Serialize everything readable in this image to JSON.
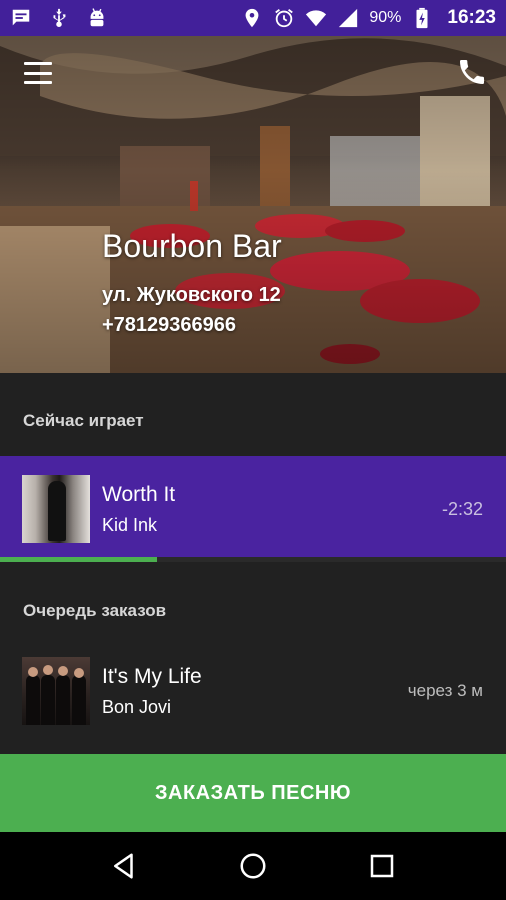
{
  "status_bar": {
    "battery": "90%",
    "time": "16:23",
    "left_icons": [
      "message-icon",
      "usb-icon",
      "android-icon"
    ],
    "right_icons": [
      "location-icon",
      "alarm-icon",
      "wifi-icon",
      "signal-icon",
      "battery-charging-icon"
    ]
  },
  "header": {
    "venue_name": "Bourbon Bar",
    "address": "ул. Жуковского 12",
    "phone": "+78129366966",
    "menu_icon": "hamburger-menu-icon",
    "call_icon": "phone-icon"
  },
  "now_playing": {
    "section_label": "Сейчас играет",
    "title": "Worth It",
    "artist": "Kid Ink",
    "time": "-2:32",
    "progress": 0.31
  },
  "queue": {
    "section_label": "Очередь заказов",
    "items": [
      {
        "title": "It's My Life",
        "artist": "Bon Jovi",
        "time": "через 3 м"
      }
    ]
  },
  "actions": {
    "order_label": "ЗАКАЗАТЬ ПЕСНЮ"
  },
  "colors": {
    "status_bar": "#42209a",
    "now_playing_bg": "#4a23a0",
    "content_bg": "#212121",
    "accent_green": "#4caf50"
  },
  "nav": [
    "back-icon",
    "home-icon",
    "recents-icon"
  ]
}
